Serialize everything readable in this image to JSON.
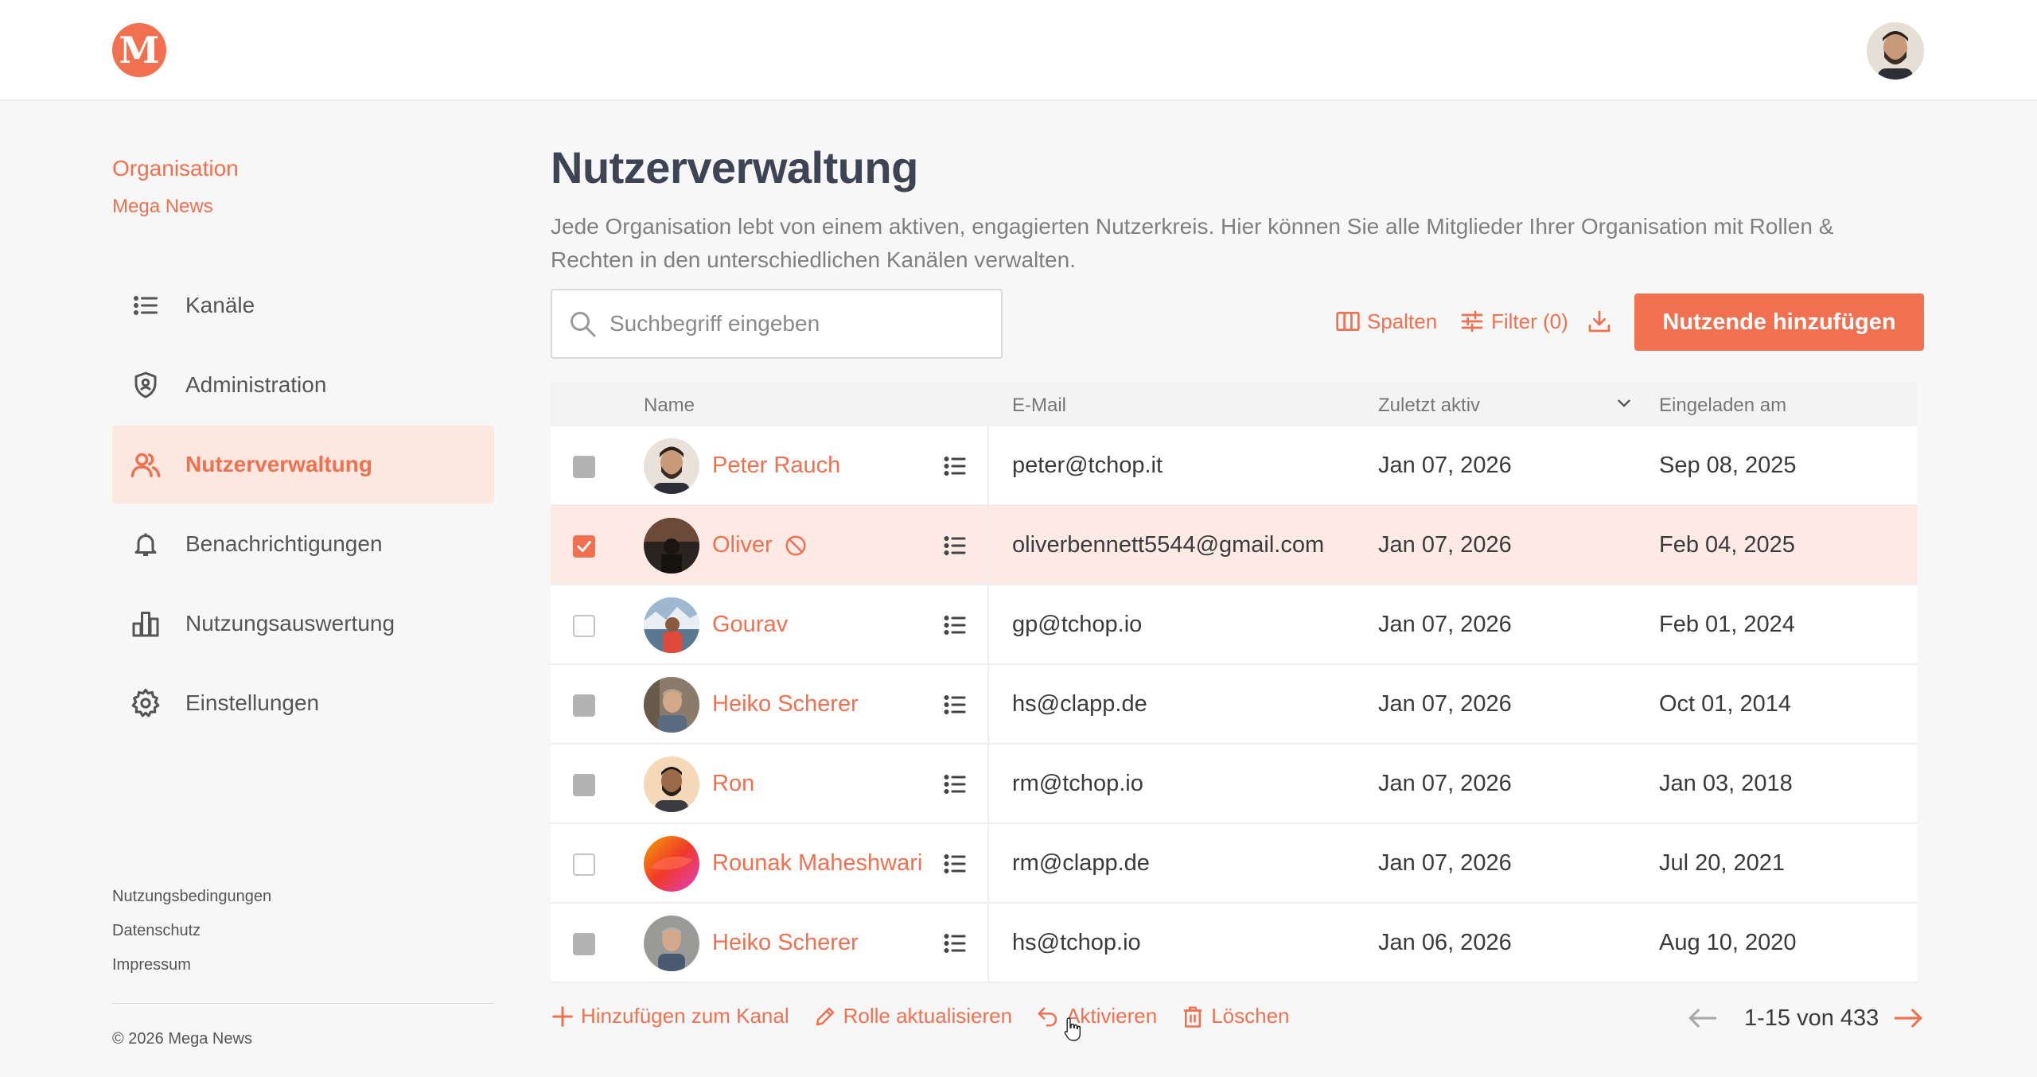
{
  "brand": {
    "logo_letter": "M",
    "accent": "#f07050"
  },
  "sidebar": {
    "org_label": "Organisation",
    "org_name": "Mega News",
    "items": [
      {
        "label": "Kanäle",
        "icon": "list-icon"
      },
      {
        "label": "Administration",
        "icon": "shield-icon"
      },
      {
        "label": "Nutzerverwaltung",
        "icon": "users-icon",
        "active": true
      },
      {
        "label": "Benachrichtigungen",
        "icon": "bell-icon"
      },
      {
        "label": "Nutzungsauswertung",
        "icon": "bar-chart-icon"
      },
      {
        "label": "Einstellungen",
        "icon": "gear-icon"
      }
    ],
    "footer_links": [
      "Nutzungsbedingungen",
      "Datenschutz",
      "Impressum"
    ],
    "copyright": "© 2026 Mega News"
  },
  "main": {
    "title": "Nutzerverwaltung",
    "description": "Jede Organisation lebt von einem aktiven, engagierten Nutzerkreis. Hier können Sie alle Mitglieder Ihrer Organisation mit Rollen & Rechten in den unterschiedlichen Kanälen verwalten.",
    "search_placeholder": "Suchbegriff eingeben",
    "columns_label": "Spalten",
    "filter_label": "Filter (0)",
    "add_button": "Nutzende hinzufügen"
  },
  "table": {
    "headers": {
      "name": "Name",
      "email": "E-Mail",
      "last_active": "Zuletzt aktiv",
      "invited": "Eingeladen am"
    },
    "rows": [
      {
        "name": "Peter Rauch",
        "email": "peter@tchop.it",
        "last_active": "Jan 07, 2026",
        "invited": "Sep 08, 2025",
        "checkbox": "gray"
      },
      {
        "name": "Oliver",
        "email": "oliverbennett5544@gmail.com",
        "last_active": "Jan 07, 2026",
        "invited": "Feb 04, 2025",
        "checkbox": "checked",
        "banned": true
      },
      {
        "name": "Gourav",
        "email": "gp@tchop.io",
        "last_active": "Jan 07, 2026",
        "invited": "Feb 01, 2024",
        "checkbox": "empty"
      },
      {
        "name": "Heiko Scherer",
        "email": "hs@clapp.de",
        "last_active": "Jan 07, 2026",
        "invited": "Oct 01, 2014",
        "checkbox": "gray"
      },
      {
        "name": "Ron",
        "email": "rm@tchop.io",
        "last_active": "Jan 07, 2026",
        "invited": "Jan 03, 2018",
        "checkbox": "gray"
      },
      {
        "name": "Rounak Maheshwari",
        "email": "rm@clapp.de",
        "last_active": "Jan 07, 2026",
        "invited": "Jul 20, 2021",
        "checkbox": "empty"
      },
      {
        "name": "Heiko Scherer",
        "email": "hs@tchop.io",
        "last_active": "Jan 06, 2026",
        "invited": "Aug 10, 2020",
        "checkbox": "gray"
      }
    ]
  },
  "bulk_actions": {
    "add_to_channel": "Hinzufügen zum Kanal",
    "update_role": "Rolle aktualisieren",
    "activate": "Aktivieren",
    "delete": "Löschen"
  },
  "pagination": {
    "text": "1-15 von 433"
  }
}
